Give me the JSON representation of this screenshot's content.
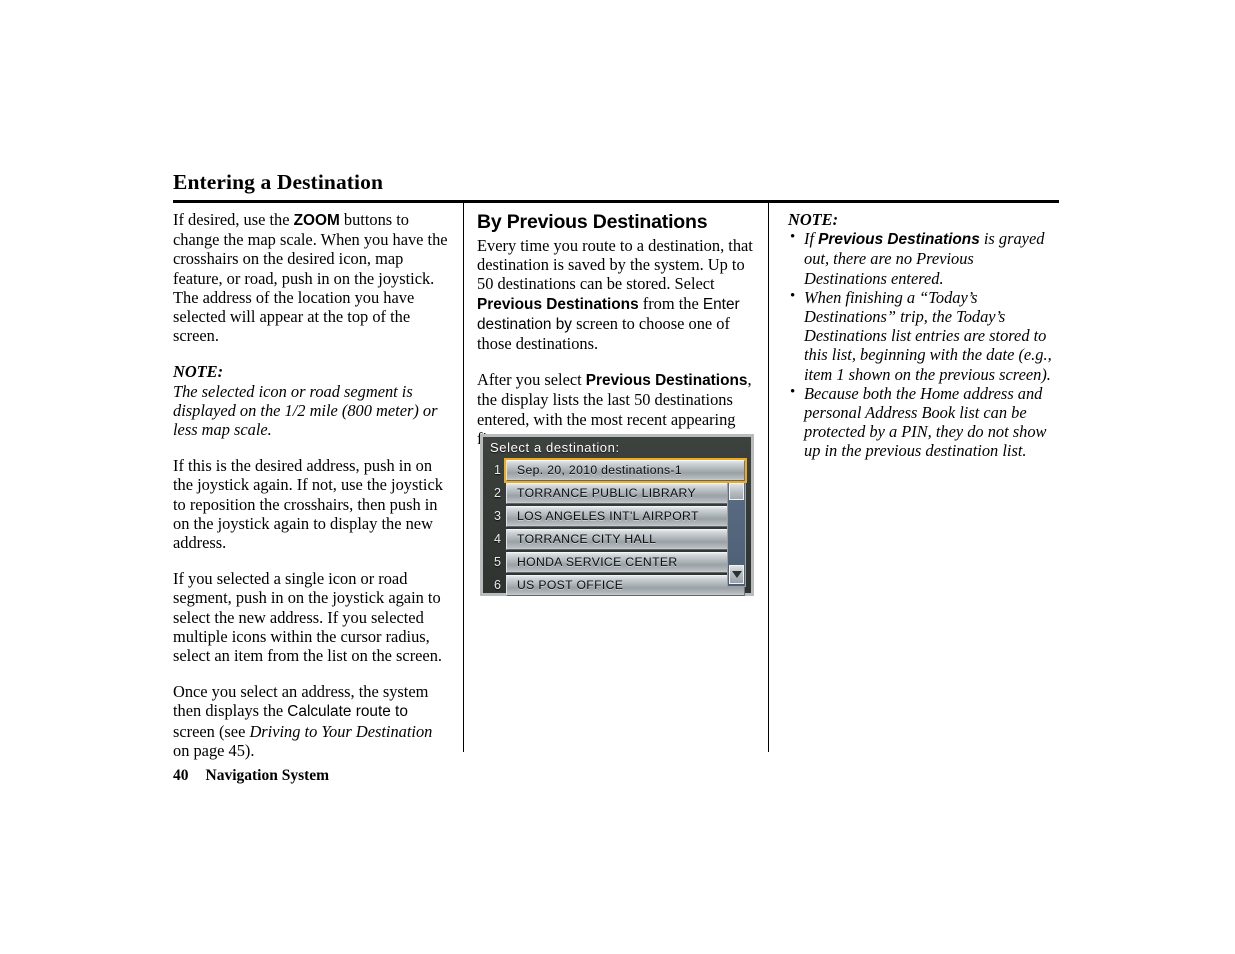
{
  "page": {
    "title": "Entering a Destination",
    "footer_page_number": "40",
    "footer_title": "Navigation System"
  },
  "left_column": {
    "para1_a": "If desired, use the ",
    "para1_ui": "ZOOM",
    "para1_b": " buttons to change the map scale. When you have the crosshairs on the desired icon, map feature, or road, push in on the joystick. The address of the location you have selected will appear at the top of the screen.",
    "note_label": "NOTE:",
    "note_text": "The selected icon or road segment is displayed on the 1/2 mile (800 meter) or less map scale.",
    "para2": "If this is the desired address, push in on the joystick again. If not, use the joystick to reposition the crosshairs, then push in on the joystick again to display the new address.",
    "para3": "If you selected a single icon or road segment, push in on the joystick again to select the new address. If you selected multiple icons within the cursor radius, select an item from the list on the screen.",
    "para4_a": "Once you select an address, the system then displays the ",
    "para4_ui": "Calculate route to",
    "para4_b": " screen (see ",
    "para4_italic": "Driving to Your Destination",
    "para4_c": " on page 45)."
  },
  "middle_column": {
    "heading": "By Previous Destinations",
    "para1_a": "Every time you route to a destination, that destination is saved by the system. Up to 50 destinations can be stored. Select ",
    "para1_ui_bold": "Previous Destinations",
    "para1_b": " from the ",
    "para1_ui_reg": "Enter destination by",
    "para1_c": " screen to choose one of those destinations.",
    "para2_a": "After you select ",
    "para2_ui_bold": "Previous Destinations",
    "para2_b": ", the display lists the last 50 destinations entered, with the most recent appearing first."
  },
  "nav_screen": {
    "title": "Select a destination:",
    "items": [
      {
        "number": "1",
        "label": "Sep. 20, 2010 destinations-1",
        "selected": true
      },
      {
        "number": "2",
        "label": "TORRANCE PUBLIC LIBRARY",
        "selected": false
      },
      {
        "number": "3",
        "label": "LOS ANGELES INT'L AIRPORT",
        "selected": false
      },
      {
        "number": "4",
        "label": "TORRANCE CITY HALL",
        "selected": false
      },
      {
        "number": "5",
        "label": "HONDA SERVICE CENTER",
        "selected": false
      },
      {
        "number": "6",
        "label": "US POST OFFICE",
        "selected": false
      }
    ],
    "colors": {
      "background": "#343936",
      "highlight": "#f0ab1b",
      "scrollbar_track": "#55677d",
      "button_face": "#aab1b5"
    }
  },
  "right_column": {
    "note_label": "NOTE:",
    "bullets": [
      {
        "a": "If ",
        "ui_bold": "Previous Destinations",
        "b": " is grayed out, there are no Previous Destinations entered."
      },
      {
        "a": "When finishing a “Today’s Destinations” trip, the Today’s Destinations list entries are stored to this list, beginning with the date (e.g., item 1 shown on the previous screen).",
        "ui_bold": "",
        "b": ""
      },
      {
        "a": "Because both the Home address and personal Address Book list can be protected by a PIN, they do not show up in the previous destination list.",
        "ui_bold": "",
        "b": ""
      }
    ]
  }
}
